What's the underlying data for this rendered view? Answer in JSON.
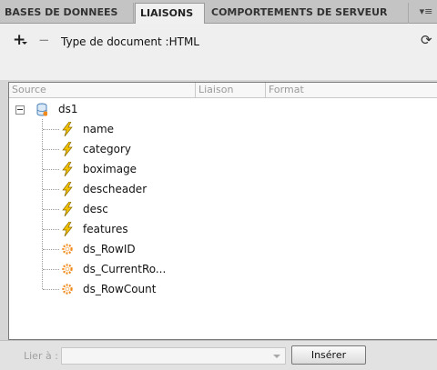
{
  "tabs": [
    {
      "label": "BASES DE DONNEES",
      "active": false
    },
    {
      "label": "LIAISONS",
      "active": true
    },
    {
      "label": "COMPORTEMENTS DE SERVEUR",
      "active": false
    }
  ],
  "toolbar": {
    "add_symbol": "+",
    "remove_symbol": "−",
    "doc_type_text": "Type de document :HTML",
    "refresh_symbol": "⟳"
  },
  "table": {
    "headers": {
      "source": "Source",
      "liaison": "Liaison",
      "format": "Format"
    },
    "dataset": {
      "name": "ds1",
      "icon": "database-icon"
    },
    "fields": [
      {
        "name": "name",
        "icon": "lightning-icon"
      },
      {
        "name": "category",
        "icon": "lightning-icon"
      },
      {
        "name": "boximage",
        "icon": "lightning-icon"
      },
      {
        "name": "descheader",
        "icon": "lightning-icon"
      },
      {
        "name": "desc",
        "icon": "lightning-icon"
      },
      {
        "name": "features",
        "icon": "lightning-icon"
      },
      {
        "name": "ds_RowID",
        "icon": "gear-icon"
      },
      {
        "name": "ds_CurrentRo...",
        "icon": "gear-icon"
      },
      {
        "name": "ds_RowCount",
        "icon": "gear-icon"
      }
    ]
  },
  "bottom": {
    "lier_label": "Lier à :",
    "lier_value": "",
    "insert_label": "Insérer"
  },
  "colors": {
    "lightning": "#e8b800",
    "gear": "#f08a1c",
    "panel_border": "#7a7a7a"
  }
}
